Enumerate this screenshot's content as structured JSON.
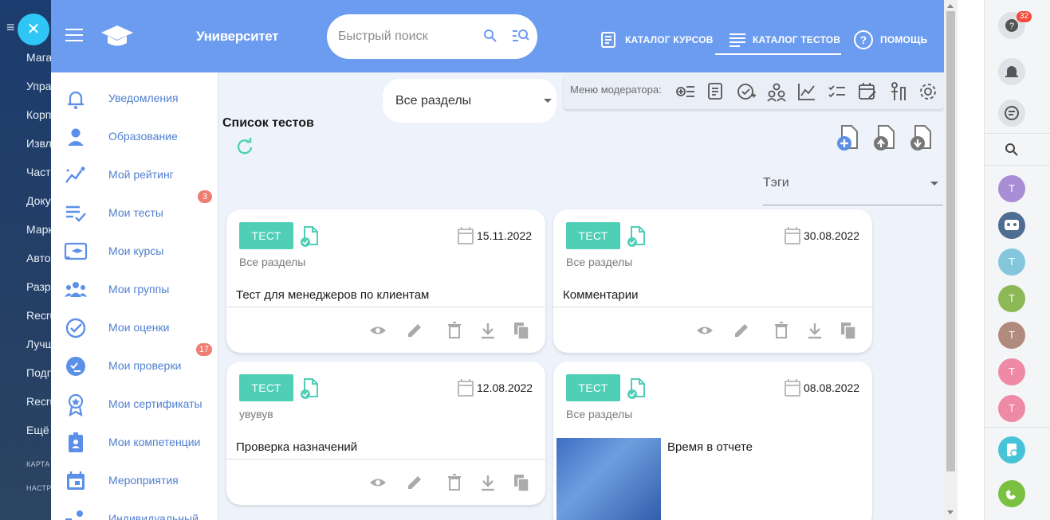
{
  "bitrix_left_menu": {
    "items": [
      "Мага",
      "Упра",
      "Корп",
      "Извл",
      "Част",
      "Доку",
      "Марк",
      "Авто",
      "Разр",
      "Recru",
      "Лучш",
      "Подп",
      "Recru",
      "Ещё"
    ],
    "small_items": [
      "КАРТА",
      "НАСТР"
    ]
  },
  "topbar": {
    "brand": "Университет",
    "search_placeholder": "Быстрый поиск",
    "nav": {
      "catalog_courses": "КАТАЛОГ КУРСОВ",
      "catalog_tests": "КАТАЛОГ ТЕСТОВ",
      "help": "ПОМОЩЬ"
    }
  },
  "sidebar": {
    "items": [
      {
        "label": "Уведомления",
        "icon": "bell-icon"
      },
      {
        "label": "Образование",
        "icon": "person-icon"
      },
      {
        "label": "Мой рейтинг",
        "icon": "rating-icon"
      },
      {
        "label": "Мои тесты",
        "icon": "checklist-icon",
        "badge": "3"
      },
      {
        "label": "Мои курсы",
        "icon": "courses-icon"
      },
      {
        "label": "Мои группы",
        "icon": "group-icon"
      },
      {
        "label": "Мои оценки",
        "icon": "check-circle-icon"
      },
      {
        "label": "Мои проверки",
        "icon": "review-icon",
        "badge": "17"
      },
      {
        "label": "Мои сертификаты",
        "icon": "certificate-icon"
      },
      {
        "label": "Мои компетенции",
        "icon": "badge-icon"
      },
      {
        "label": "Мероприятия",
        "icon": "calendar-icon"
      },
      {
        "label": "Индивидуальный",
        "icon": "plan-icon"
      }
    ]
  },
  "filters": {
    "sections_value": "Все разделы",
    "moderator_label": "Меню модератора:",
    "tags_placeholder": "Тэги"
  },
  "list": {
    "title": "Список тестов"
  },
  "cards": [
    {
      "tag": "ТЕСТ",
      "date": "15.11.2022",
      "section": "Все разделы",
      "name": "Тест для менеджеров по клиентам"
    },
    {
      "tag": "ТЕСТ",
      "date": "30.08.2022",
      "section": "Все разделы",
      "name": "Комментарии"
    },
    {
      "tag": "ТЕСТ",
      "date": "12.08.2022",
      "section": "увувув",
      "name": "Проверка назначений"
    },
    {
      "tag": "ТЕСТ",
      "date": "08.08.2022",
      "section": "Все разделы",
      "name": "Время в отчете"
    }
  ],
  "right_panel": {
    "help_badge": "32",
    "avatars": [
      {
        "letter": "T",
        "color": "#a98ed6"
      },
      {
        "letter": "T",
        "color": "#84c7dc"
      },
      {
        "letter": "T",
        "color": "#8cb855"
      },
      {
        "letter": "T",
        "color": "#b08a7d"
      },
      {
        "letter": "T",
        "color": "#ef8aa6"
      },
      {
        "letter": "T",
        "color": "#ef8aa6"
      }
    ]
  },
  "colors": {
    "topbar": "#6c9cf0",
    "accent_teal": "#4fcfb6",
    "badge": "#ef7d72",
    "link": "#4f7fcf"
  }
}
